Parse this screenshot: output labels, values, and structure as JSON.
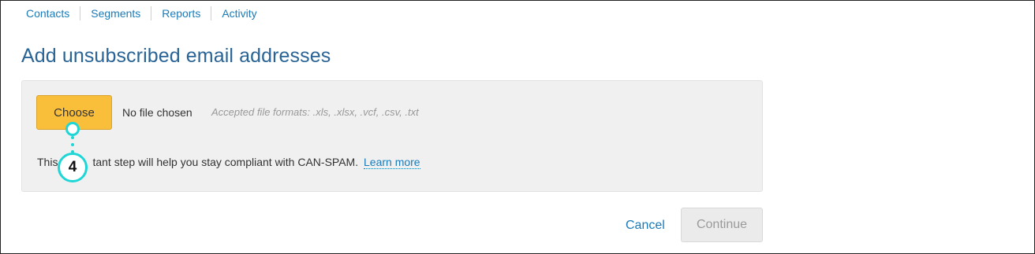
{
  "nav": {
    "items": [
      {
        "label": "Contacts"
      },
      {
        "label": "Segments"
      },
      {
        "label": "Reports"
      },
      {
        "label": "Activity"
      }
    ]
  },
  "page": {
    "title": "Add unsubscribed email addresses"
  },
  "upload": {
    "choose_label": "Choose",
    "file_status": "No file chosen",
    "formats_hint": "Accepted file formats: .xls, .xlsx, .vcf, .csv, .txt",
    "help_before": "This",
    "help_after": "tant step will help you stay compliant with CAN-SPAM.",
    "learn_more": "Learn more"
  },
  "callout": {
    "number": "4",
    "color": "#1ed6d6"
  },
  "actions": {
    "cancel_label": "Cancel",
    "continue_label": "Continue"
  },
  "colors": {
    "link": "#1a7bb8",
    "title": "#2a6496",
    "primary_button": "#f9bf3b",
    "disabled_button": "#ebebeb"
  }
}
